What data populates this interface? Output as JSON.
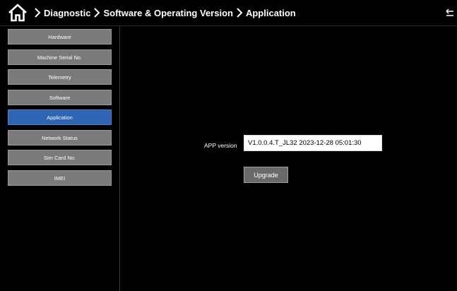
{
  "breadcrumb": {
    "items": [
      "Diagnostic",
      "Software & Operating Version",
      "Application"
    ]
  },
  "sidebar": {
    "items": [
      {
        "label": "Hardware"
      },
      {
        "label": "Machine Serial No."
      },
      {
        "label": "Telemetry"
      },
      {
        "label": "Software"
      },
      {
        "label": "Application",
        "active": true
      },
      {
        "label": "Network Status"
      },
      {
        "label": "Sim Card No."
      },
      {
        "label": "IMEI"
      }
    ]
  },
  "main": {
    "app_version_label": "APP version",
    "app_version_value": "V1.0.0.4.T_JL32 2023-12-28 05:01:30",
    "upgrade_label": "Upgrade"
  },
  "colors": {
    "background": "#000000",
    "sidebar_item": "#7a7a7a",
    "sidebar_active": "#2e64b4",
    "button": "#6a6a6a"
  },
  "icons": {
    "home": "home-icon",
    "separator": "chevron-right-icon",
    "back": "back-arrow-icon"
  }
}
